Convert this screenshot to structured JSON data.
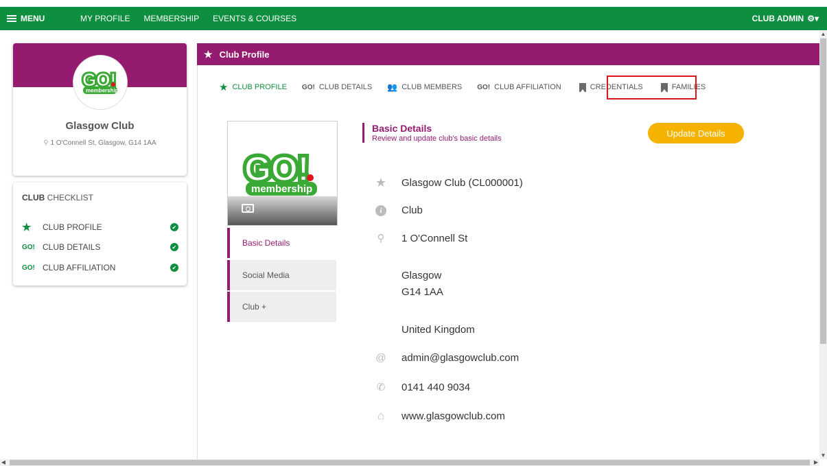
{
  "topbar": {
    "menu_label": "MENU",
    "links": [
      "MY PROFILE",
      "MEMBERSHIP",
      "EVENTS & COURSES"
    ],
    "admin_label": "CLUB ADMIN"
  },
  "brand": {
    "green": "#0e8e3f",
    "purple": "#941b6f",
    "yellow": "#f5b300",
    "logo_text": "GO!",
    "logo_sub": "membership"
  },
  "profile": {
    "name": "Glasgow Club",
    "address": "1 O'Connell St, Glasgow, G14 1AA"
  },
  "checklist": {
    "title_bold": "CLUB",
    "title_rest": " CHECKLIST",
    "items": [
      {
        "icon": "star-icon",
        "label": "CLUB PROFILE"
      },
      {
        "icon": "go-icon",
        "label": "CLUB DETAILS"
      },
      {
        "icon": "go-icon",
        "label": "CLUB AFFILIATION"
      }
    ]
  },
  "main": {
    "header_title": "Club Profile",
    "tabs": [
      {
        "label": "CLUB PROFILE",
        "icon": "star-icon"
      },
      {
        "label": "CLUB DETAILS",
        "icon": "go-icon"
      },
      {
        "label": "CLUB MEMBERS",
        "icon": "members-icon"
      },
      {
        "label": "CLUB AFFILIATION",
        "icon": "go-icon"
      },
      {
        "label": "CREDENTIALS",
        "icon": "bookmark-icon"
      },
      {
        "label": "FAMILIES",
        "icon": "bookmark-icon"
      }
    ],
    "side_tabs": [
      "Basic Details",
      "Social Media",
      "Club +"
    ],
    "basic_details": {
      "title": "Basic Details",
      "subtitle": "Review and update club's basic details",
      "update_label": "Update Details",
      "club_name": "Glasgow Club (CL000001)",
      "type": "Club",
      "street": "1 O'Connell St",
      "city": "Glasgow",
      "postcode": "G14 1AA",
      "country": "United Kingdom",
      "email": "admin@glasgowclub.com",
      "phone": "0141 440 9034",
      "website": "www.glasgowclub.com"
    }
  }
}
